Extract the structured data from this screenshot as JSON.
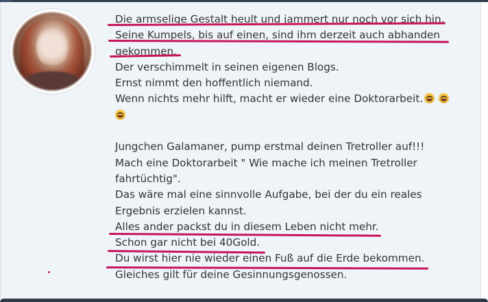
{
  "post": {
    "avatar_alt": "",
    "lines": [
      "Die armselige Gestalt heult und jammert nur noch vor sich hin.",
      "Seine Kumpels, bis auf einen,  sind ihm derzeit auch abhanden",
      "gekommen.",
      "Der verschimmelt in seinen eigenen Blogs.",
      "Ernst nimmt den hoffentlich niemand.",
      "Wenn nichts mehr hilft, macht er wieder eine Doktorarbeit.",
      "",
      "",
      "Jungchen Galamaner, pump erstmal deinen Tretroller auf!!!",
      "Mach eine Doktorarbeit \" Wie mache ich meinen Tretroller",
      "fahrtüchtig\".",
      "Das wäre mal eine sinnvolle Aufgabe, bei der du ein reales",
      "Ergebnis erzielen kannst.",
      "Alles ander packst du in diesem Leben nicht mehr.",
      "Schon gar nicht bei 40Gold.",
      "Du wirst hier nie wieder einen Fuß auf die Erde bekommen.",
      "Gleiches gilt für deine Gesinnungsgenossen."
    ],
    "emojis": [
      "laughing-tears-emoji",
      "rofl-emoji",
      "laughing-tears-emoji"
    ]
  },
  "annotation_color": "#c7125c",
  "colors": {
    "text": "#333333",
    "post_background": "#eef4f8",
    "frame": "#2f3b4a"
  }
}
